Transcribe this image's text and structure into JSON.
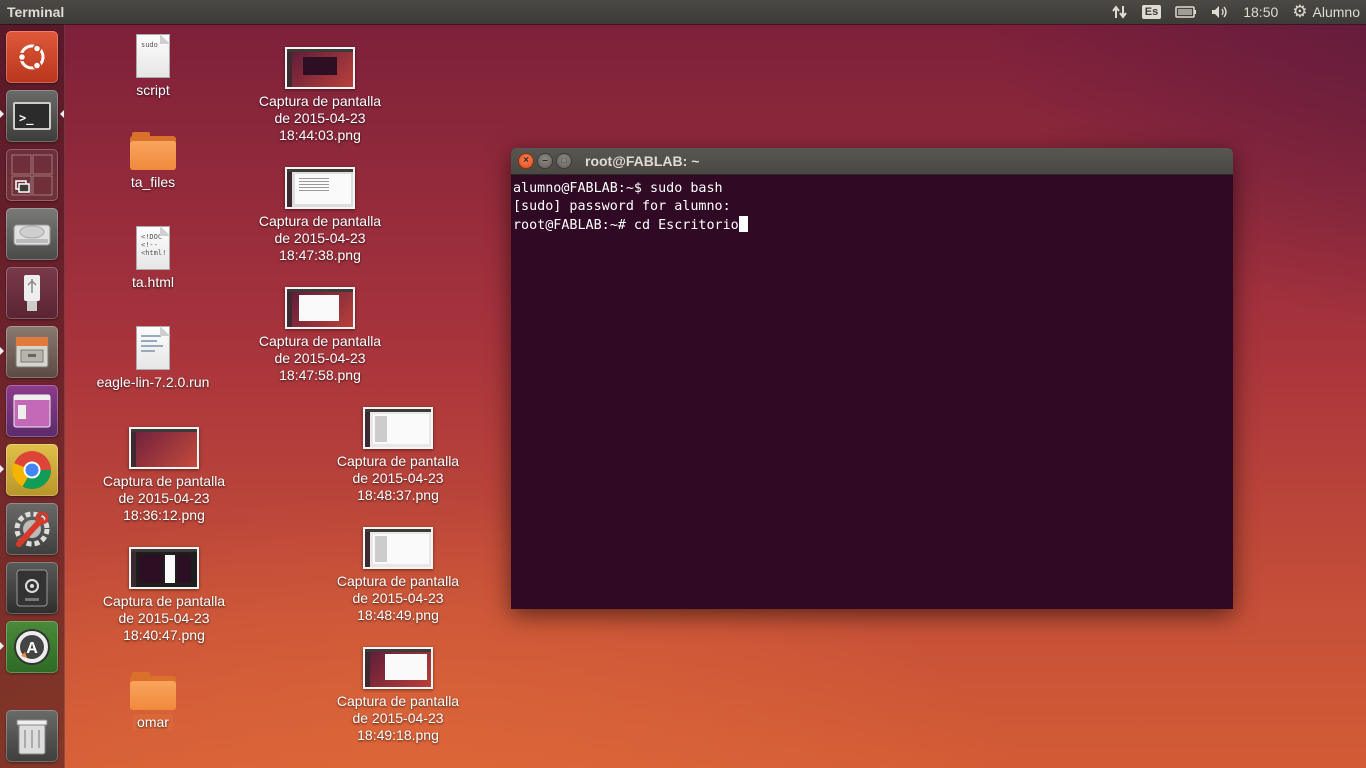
{
  "topbar": {
    "app_title": "Terminal",
    "keyboard_layout": "Es",
    "clock": "18:50",
    "user": "Alumno"
  },
  "launcher": {
    "items": [
      {
        "name": "dash-home"
      },
      {
        "name": "terminal"
      },
      {
        "name": "workspace-switcher"
      },
      {
        "name": "hard-drive"
      },
      {
        "name": "usb-drive"
      },
      {
        "name": "files"
      },
      {
        "name": "unity-app"
      },
      {
        "name": "chrome"
      },
      {
        "name": "system-settings"
      },
      {
        "name": "disk-app"
      },
      {
        "name": "software-updater"
      },
      {
        "name": "trash"
      }
    ]
  },
  "desktop": {
    "icons": [
      {
        "label": "script",
        "type": "doc",
        "mini": "sudo"
      },
      {
        "label": "ta_files",
        "type": "folder"
      },
      {
        "label": "ta.html",
        "type": "doc",
        "mini": "<!DOC\n<!--\n<html!"
      },
      {
        "label": "eagle-lin-7.2.0.run",
        "type": "doc",
        "mini": ""
      },
      {
        "label": "Captura de pantalla de 2015-04-23 18:36:12.png",
        "type": "thumb"
      },
      {
        "label": "Captura de pantalla de 2015-04-23 18:40:47.png",
        "type": "thumb"
      },
      {
        "label": "omar",
        "type": "folder"
      },
      {
        "label": "Captura de pantalla de 2015-04-23 18:44:03.png",
        "type": "thumb"
      },
      {
        "label": "Captura de pantalla de 2015-04-23 18:47:38.png",
        "type": "thumb"
      },
      {
        "label": "Captura de pantalla de 2015-04-23 18:47:58.png",
        "type": "thumb"
      },
      {
        "label": "Captura de pantalla de 2015-04-23 18:48:37.png",
        "type": "thumb"
      },
      {
        "label": "Captura de pantalla de 2015-04-23 18:48:49.png",
        "type": "thumb"
      },
      {
        "label": "Captura de pantalla de 2015-04-23 18:49:18.png",
        "type": "thumb"
      }
    ]
  },
  "terminal": {
    "title": "root@FABLAB: ~",
    "lines": [
      "alumno@FABLAB:~$ sudo bash",
      "[sudo] password for alumno:",
      "root@FABLAB:~# cd Escritorio"
    ]
  },
  "colors": {
    "terminal_bg": "#300a24",
    "panel_bg": "#3c3b37",
    "close_button": "#df4b16"
  }
}
